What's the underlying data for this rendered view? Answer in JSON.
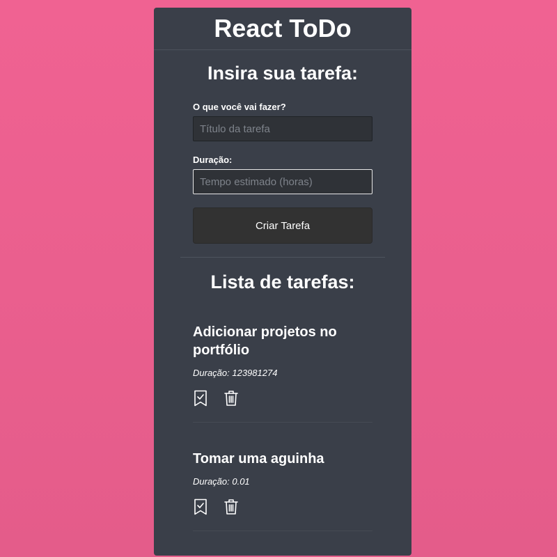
{
  "app": {
    "title": "React ToDo"
  },
  "form": {
    "heading": "Insira sua tarefa:",
    "title_label": "O que você vai fazer?",
    "title_placeholder": "Título da tarefa",
    "duration_label": "Duração:",
    "duration_placeholder": "Tempo estimado (horas)",
    "submit_label": "Criar Tarefa"
  },
  "list": {
    "heading": "Lista de tarefas:",
    "tasks": [
      {
        "title": "Adicionar projetos no portfólio",
        "duration": "Duração: 123981274"
      },
      {
        "title": "Tomar uma aguinha",
        "duration": "Duração: 0.01"
      }
    ]
  },
  "icons": {
    "complete": "bookmark-check-icon",
    "delete": "trash-icon"
  },
  "colors": {
    "background": "#f06292",
    "card": "#3a3f49",
    "button": "#323232",
    "text": "#ffffff"
  }
}
